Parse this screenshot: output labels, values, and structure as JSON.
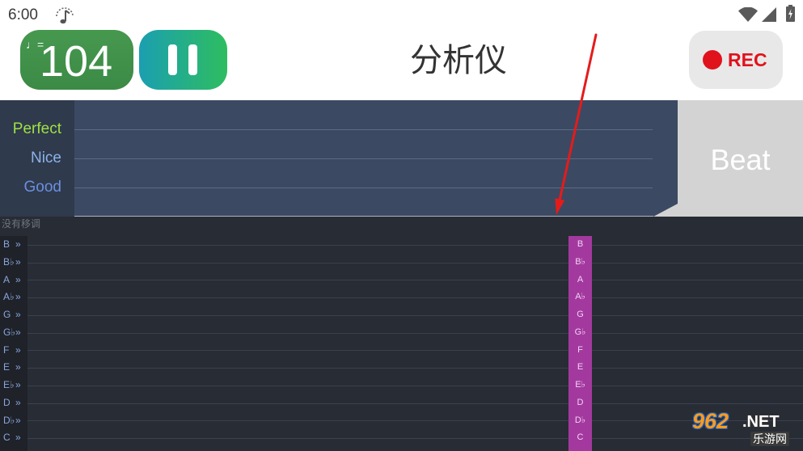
{
  "status_bar": {
    "time": "6:00",
    "icons": {
      "metronome": "metronome-icon",
      "wifi": "wifi-icon",
      "signal": "cellular-signal-icon",
      "battery": "battery-charging-icon"
    }
  },
  "header": {
    "tempo_prefix": "♩=",
    "tempo_bpm": "104",
    "pause_icon": "pause-icon",
    "title": "分析仪",
    "rec_icon": "record-dot-icon",
    "rec_label": "REC"
  },
  "accuracy": {
    "perfect": "Perfect",
    "nice": "Nice",
    "good": "Good",
    "beat": "Beat"
  },
  "transpose_status": "没有移调",
  "notes": {
    "indicator": "»",
    "rows": [
      "B",
      "B♭",
      "A",
      "A♭",
      "G",
      "G♭",
      "F",
      "E",
      "E♭",
      "D",
      "D♭",
      "C"
    ]
  },
  "watermark": {
    "logo_number": "962",
    "logo_suffix": ".NET",
    "site": "乐游网"
  },
  "colors": {
    "tempo_button": "#3e8f4a",
    "pause_gradient_start": "#1b9fb0",
    "pause_gradient_end": "#2ebd60",
    "rec_red": "#e0121c",
    "perfect": "#9fe244",
    "nice": "#8cb2ea",
    "good": "#6b8fe0",
    "highlight_column": "#a3399f",
    "annotation_arrow": "#e51b1b"
  }
}
